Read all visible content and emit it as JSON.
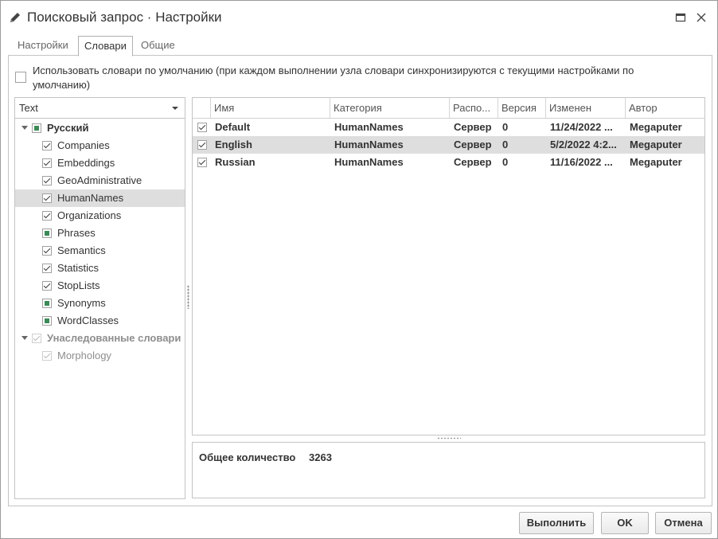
{
  "window": {
    "title": "Поисковый запрос · Настройки"
  },
  "tabs": [
    {
      "label": "Настройки",
      "active": false
    },
    {
      "label": "Словари",
      "active": true
    },
    {
      "label": "Общие",
      "active": false
    }
  ],
  "use_default": {
    "checked": false,
    "label": "Использовать словари по умолчанию (при каждом выполнении узла словари синхронизируются с текущими настройками по умолчанию)"
  },
  "language_combo": {
    "value": "Text"
  },
  "tree": {
    "groups": [
      {
        "label": "Русский",
        "state": "partial",
        "items": [
          {
            "label": "Companies",
            "state": "checked"
          },
          {
            "label": "Embeddings",
            "state": "checked"
          },
          {
            "label": "GeoAdministrative",
            "state": "checked"
          },
          {
            "label": "HumanNames",
            "state": "checked",
            "selected": true
          },
          {
            "label": "Organizations",
            "state": "checked"
          },
          {
            "label": "Phrases",
            "state": "partial"
          },
          {
            "label": "Semantics",
            "state": "checked"
          },
          {
            "label": "Statistics",
            "state": "checked"
          },
          {
            "label": "StopLists",
            "state": "checked"
          },
          {
            "label": "Synonyms",
            "state": "partial"
          },
          {
            "label": "WordClasses",
            "state": "partial"
          }
        ]
      },
      {
        "label": "Унаследованные словари",
        "state": "checked-disabled",
        "items": [
          {
            "label": "Morphology",
            "state": "checked-disabled"
          }
        ]
      }
    ]
  },
  "grid": {
    "columns": [
      "Имя",
      "Категория",
      "Распо...",
      "Версия",
      "Изменен",
      "Автор"
    ],
    "rows": [
      {
        "checked": true,
        "name": "Default",
        "category": "HumanNames",
        "location": "Сервер",
        "version": "0",
        "modified": "11/24/2022 ...",
        "author": "Megaputer",
        "selected": false
      },
      {
        "checked": true,
        "name": "English",
        "category": "HumanNames",
        "location": "Сервер",
        "version": "0",
        "modified": "5/2/2022 4:2...",
        "author": "Megaputer",
        "selected": true
      },
      {
        "checked": true,
        "name": "Russian",
        "category": "HumanNames",
        "location": "Сервер",
        "version": "0",
        "modified": "11/16/2022 ...",
        "author": "Megaputer",
        "selected": false
      }
    ]
  },
  "summary": {
    "label": "Общее количество",
    "value": "3263"
  },
  "footer": {
    "run_label": "Выполнить",
    "ok_label": "OK",
    "cancel_label": "Отмена"
  },
  "colors": {
    "check_green": "#3b8a57",
    "selection": "#dedede",
    "border": "#c4c4c4"
  }
}
